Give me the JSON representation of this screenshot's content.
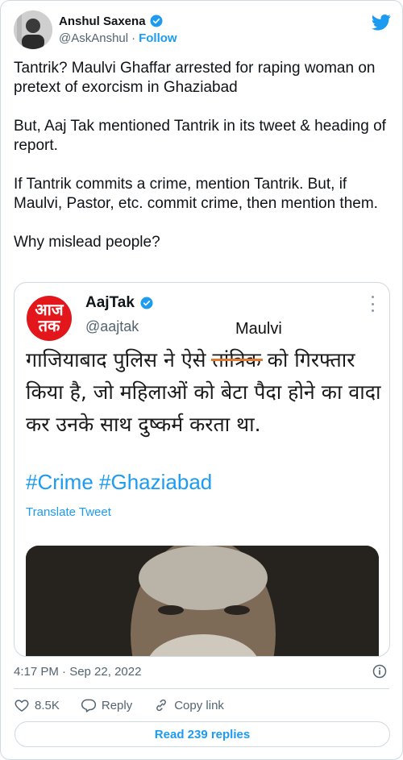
{
  "author": {
    "name": "Anshul Saxena",
    "handle": "@AskAnshul",
    "follow_label": "Follow",
    "separator": "·"
  },
  "tweet_paragraphs": [
    "Tantrik? Maulvi Ghaffar arrested for raping woman on pretext of exorcism in Ghaziabad",
    "But, Aaj Tak mentioned Tantrik in its tweet & heading of report.",
    "If Tantrik commits a crime, mention Tantrik. But, if Maulvi, Pastor, etc. commit crime, then mention them.",
    "Why mislead people?"
  ],
  "media": {
    "logo_line1": "आज",
    "logo_line2": "तक",
    "name": "AajTak",
    "handle": "@aajtak",
    "overlay_word": "Maulvi",
    "hindi_before": "गाजियाबाद पुलिस ने ऐसे ",
    "hindi_struck": "तांत्रिक",
    "hindi_after": " को गिरफ्तार किया है, जो महिलाओं को बेटा पैदा होने का वादा कर उनके साथ दुष्कर्म करता था.",
    "hashtags": "#Crime #Ghaziabad",
    "translate_label": "Translate Tweet"
  },
  "timestamp": "4:17 PM · Sep 22, 2022",
  "actions": {
    "like_count": "8.5K",
    "reply_label": "Reply",
    "copy_label": "Copy link"
  },
  "read_replies_label": "Read 239 replies",
  "colors": {
    "accent": "#1d9bf0",
    "aajtak_red": "#e3161b",
    "strike": "#e07a31"
  },
  "icons": [
    "verified-icon",
    "twitter-bird-icon",
    "more-icon",
    "info-icon",
    "heart-icon",
    "reply-icon",
    "link-icon"
  ]
}
